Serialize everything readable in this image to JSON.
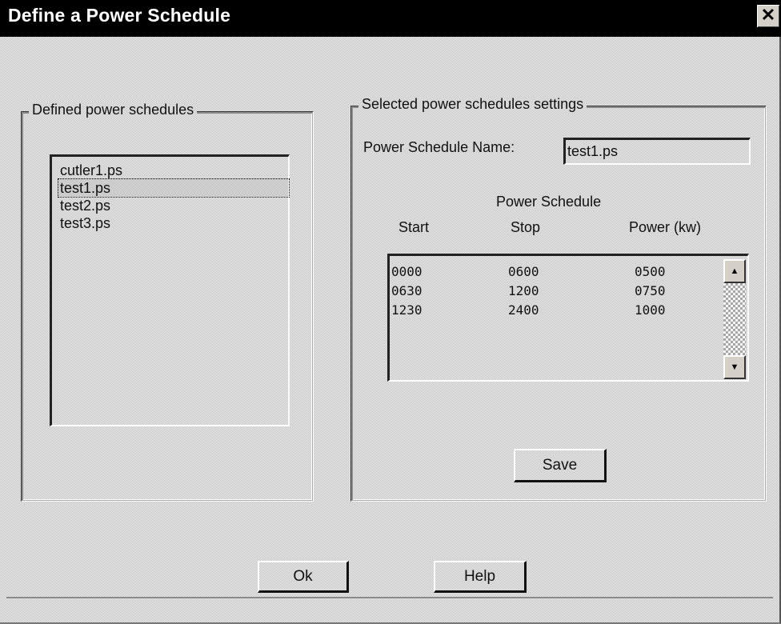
{
  "window": {
    "title": "Define a Power Schedule",
    "close_glyph": "✕"
  },
  "left_group": {
    "label": "Defined power schedules",
    "items": [
      "cutler1.ps",
      "test1.ps",
      "test2.ps",
      "test3.ps"
    ],
    "selected_index": 1
  },
  "right_group": {
    "label": "Selected power schedules settings",
    "name_label": "Power Schedule Name:",
    "name_value": "test1.ps",
    "table_title": "Power Schedule",
    "columns": [
      "Start",
      "Stop",
      "Power (kw)"
    ],
    "rows": [
      [
        "0000",
        "0600",
        "0500"
      ],
      [
        "0630",
        "1200",
        "0750"
      ],
      [
        "1230",
        "2400",
        "1000"
      ]
    ],
    "save_label": "Save"
  },
  "buttons": {
    "ok_label": "Ok",
    "help_label": "Help"
  },
  "icons": {
    "scroll_up": "up-arrow-icon",
    "scroll_down": "down-arrow-icon"
  }
}
